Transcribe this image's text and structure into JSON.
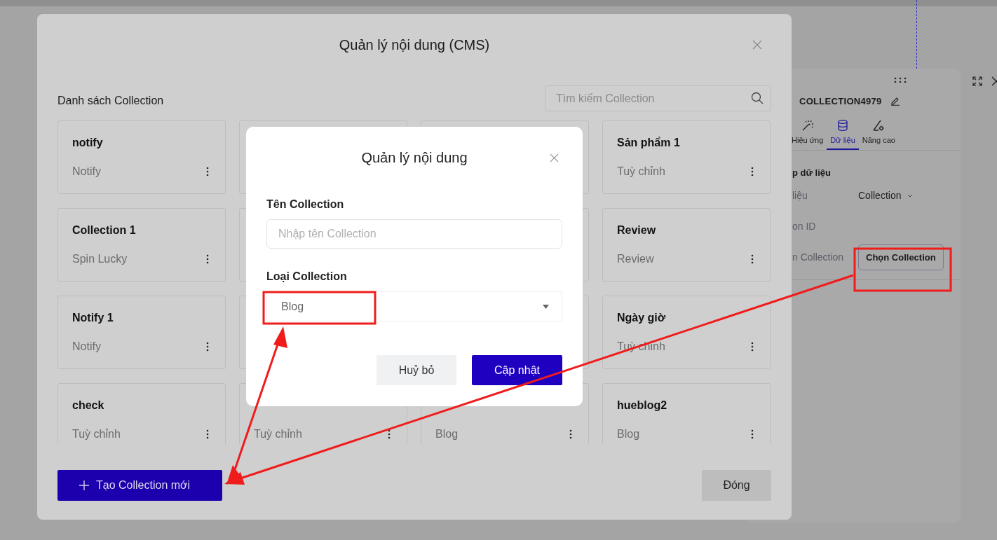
{
  "side_panel": {
    "title": "COLLECTION4979",
    "tabs": [
      {
        "label": "Hiệu ứng",
        "selected": false,
        "kind": "effects"
      },
      {
        "label": "Dữ liệu",
        "selected": true,
        "kind": "data"
      },
      {
        "label": "Nâng cao",
        "selected": false,
        "kind": "advanced"
      }
    ],
    "section_title": "p dữ liệu",
    "rows": [
      {
        "kind": "select",
        "label": "liệu",
        "value": "Collection"
      },
      {
        "kind": "text",
        "label": "on ID"
      },
      {
        "kind": "button",
        "label": "n Collection",
        "button": "Chọn Collection"
      }
    ]
  },
  "main_dialog": {
    "title": "Quản lý nội dung (CMS)",
    "section_title": "Danh sách Collection",
    "search": {
      "placeholder": "Tìm kiếm Collection"
    },
    "cards": [
      {
        "kind": "card",
        "title": "notify",
        "type": "Notify"
      },
      {
        "kind": "covered"
      },
      {
        "kind": "covered"
      },
      {
        "kind": "card",
        "title": "Sản phẩm 1",
        "type": "Tuỳ chỉnh"
      },
      {
        "kind": "card",
        "title": "Collection 1",
        "type": "Spin Lucky"
      },
      {
        "kind": "covered"
      },
      {
        "kind": "covered"
      },
      {
        "kind": "card",
        "title": "Review",
        "type": "Review"
      },
      {
        "kind": "card",
        "title": "Notify 1",
        "type": "Notify"
      },
      {
        "kind": "covered"
      },
      {
        "kind": "covered"
      },
      {
        "kind": "card",
        "title": "Ngày giờ",
        "type": "Tuỳ chỉnh"
      },
      {
        "kind": "card",
        "title": "check",
        "type": "Tuỳ chỉnh"
      },
      {
        "kind": "card",
        "type": "Tuỳ chỉnh"
      },
      {
        "kind": "card",
        "type": "Blog"
      },
      {
        "kind": "card",
        "title": "hueblog2",
        "type": "Blog"
      }
    ],
    "create_button": "Tạo Collection mới",
    "close_button": "Đóng"
  },
  "modal": {
    "title": "Quản lý nội dung",
    "name_field": {
      "label": "Tên Collection",
      "placeholder": "Nhập tên Collection"
    },
    "type_field": {
      "label": "Loại Collection",
      "value": "Blog"
    },
    "cancel_button": "Huỷ bỏ",
    "confirm_button": "Cập nhật"
  }
}
